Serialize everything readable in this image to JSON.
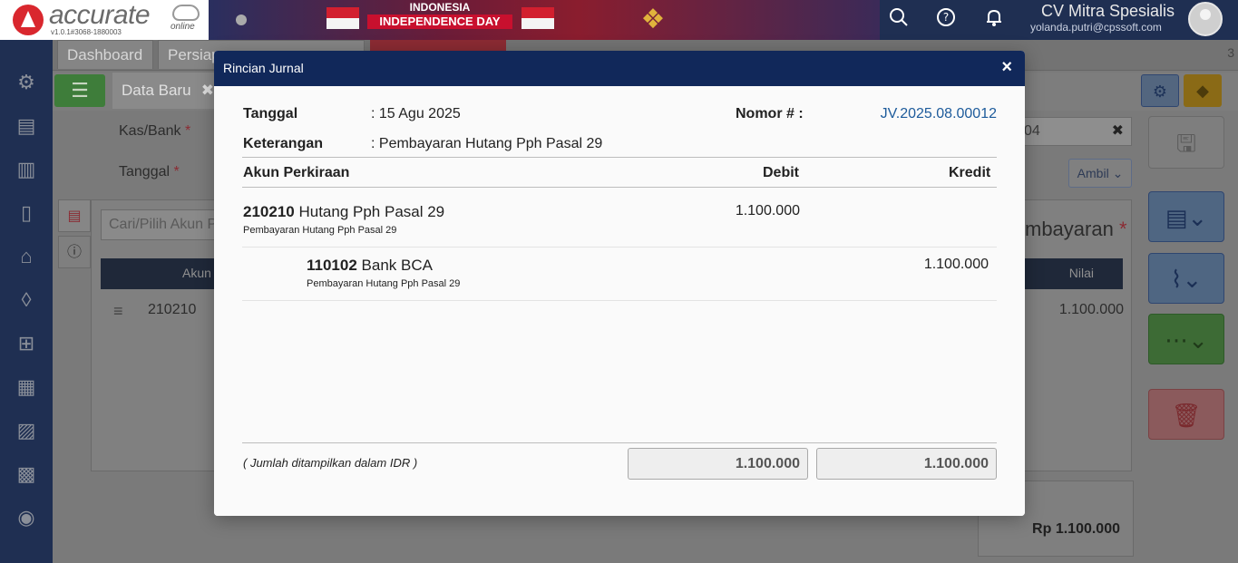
{
  "app": {
    "logo_text": "accurate",
    "logo_sub": "online",
    "version": "v1.0.1#3068-1880003",
    "banner_line1": "INDONESIA",
    "banner_line2": "INDEPENDENCE DAY",
    "company_name": "CV Mitra Spesialis",
    "user_email": "yolanda.putri@cpssoft.com"
  },
  "icons": {
    "header": [
      "search-icon",
      "help-icon",
      "bell-icon"
    ],
    "sidebar": [
      "gear-icon",
      "cashier-icon",
      "building-icon",
      "book-icon",
      "bank-icon",
      "bag-icon",
      "cart-icon",
      "warehouse-icon",
      "factory-icon",
      "tax-icon",
      "report-icon"
    ]
  },
  "tabs": {
    "dashboard": "Dashboard",
    "persiapan": "Persiap",
    "overflow_count": "3"
  },
  "form": {
    "data_tab": "Data Baru",
    "kas_bank_label": "Kas/Bank",
    "tanggal_label": "Tanggal",
    "right_field_value": "04",
    "ambil_label": "Ambil",
    "search_placeholder": "Cari/Pilih Akun P",
    "grid_head_akun": "Akun",
    "grid_head_nilai": "Nilai",
    "row_code": "210210",
    "row_value": "1.100.000",
    "pembayaran_label": "mbayaran",
    "total_label": "Rp 1.100.000"
  },
  "modal": {
    "title": "Rincian Jurnal",
    "close_label": "×",
    "tanggal_label": "Tanggal",
    "tanggal_value": ": 15 Agu 2025",
    "keterangan_label": "Keterangan",
    "keterangan_value": ": Pembayaran Hutang Pph Pasal 29",
    "nomor_label": "Nomor # :",
    "nomor_value": "JV.2025.08.00012",
    "columns": {
      "akun": "Akun Perkiraan",
      "debit": "Debit",
      "kredit": "Kredit"
    },
    "rows": [
      {
        "code": "210210",
        "name": "Hutang Pph Pasal 29",
        "note": "Pembayaran Hutang Pph Pasal 29",
        "debit": "1.100.000",
        "kredit": ""
      },
      {
        "code": "110102",
        "name": "Bank BCA",
        "note": "Pembayaran Hutang Pph Pasal 29",
        "debit": "",
        "kredit": "1.100.000"
      }
    ],
    "footer_note": "( Jumlah ditampilkan dalam IDR )",
    "total_debit": "1.100.000",
    "total_kredit": "1.100.000"
  },
  "colors": {
    "header_bg": "#11285a",
    "nomor_link": "#1d5b9b",
    "sidebar_bg": "#1f2f52"
  }
}
